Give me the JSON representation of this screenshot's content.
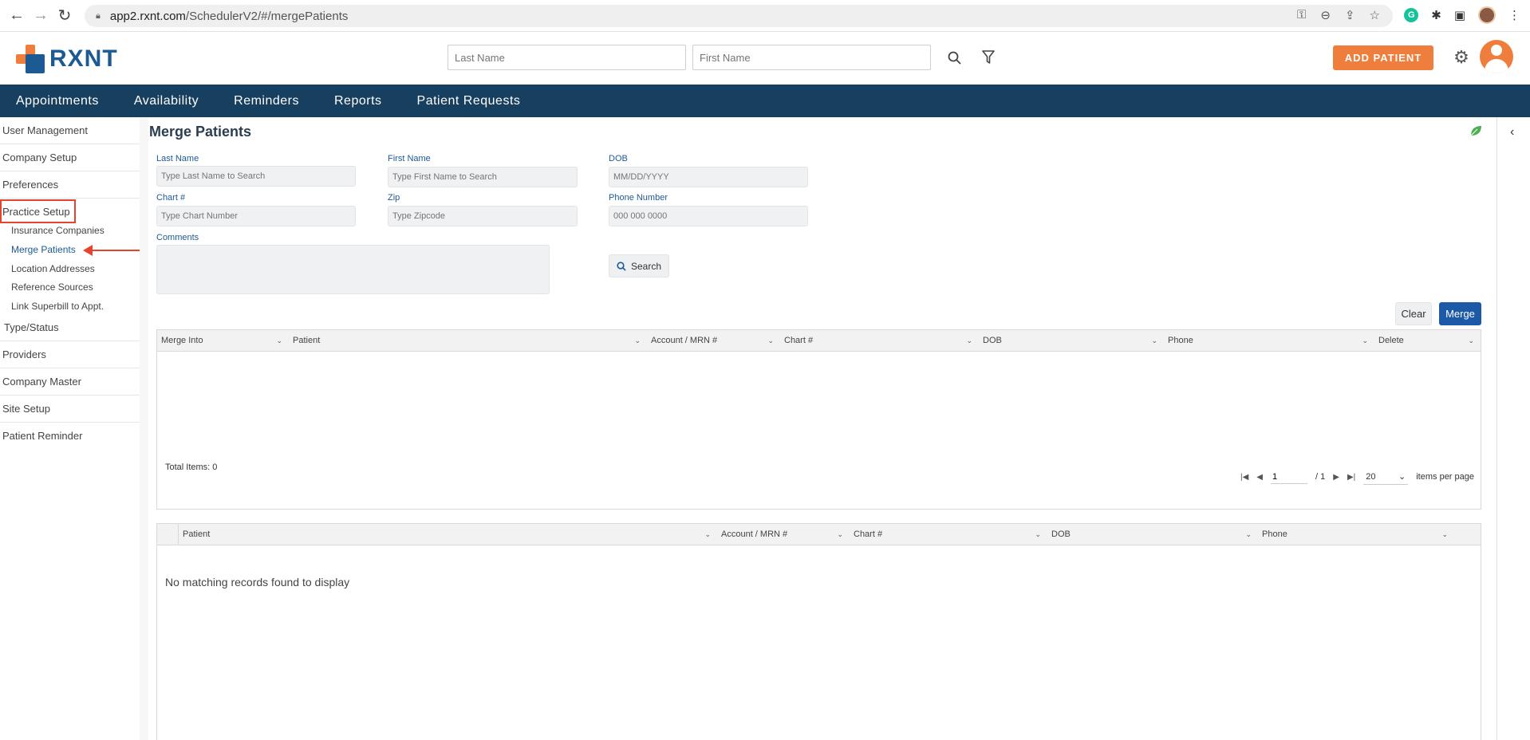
{
  "browser": {
    "url_host": "app2.rxnt.com",
    "url_path": "/SchedulerV2/#/mergePatients"
  },
  "header": {
    "logo_text": "RXNT",
    "last_name_placeholder": "Last Name",
    "first_name_placeholder": "First Name",
    "add_patient_label": "ADD PATIENT"
  },
  "nav": {
    "items": [
      "Appointments",
      "Availability",
      "Reminders",
      "Reports",
      "Patient Requests"
    ]
  },
  "sidebar": {
    "user_management": "User Management",
    "company_setup": "Company Setup",
    "preferences": "Preferences",
    "practice_setup": "Practice Setup",
    "sub_items": [
      "Insurance Companies",
      "Merge Patients",
      "Location Addresses",
      "Reference Sources",
      "Link Superbill to Appt."
    ],
    "type_status": "Type/Status",
    "providers": "Providers",
    "company_master": "Company Master",
    "site_setup": "Site Setup",
    "patient_reminder": "Patient Reminder"
  },
  "page": {
    "title": "Merge Patients"
  },
  "form": {
    "last_name_label": "Last Name",
    "last_name_placeholder": "Type Last Name to Search",
    "first_name_label": "First Name",
    "first_name_placeholder": "Type First Name to Search",
    "dob_label": "DOB",
    "dob_placeholder": "MM/DD/YYYY",
    "chart_label": "Chart #",
    "chart_placeholder": "Type Chart Number",
    "zip_label": "Zip",
    "zip_placeholder": "Type Zipcode",
    "phone_label": "Phone Number",
    "phone_placeholder": "000 000 0000",
    "comments_label": "Comments",
    "search_label": "Search",
    "clear_label": "Clear",
    "merge_label": "Merge"
  },
  "merge_grid": {
    "columns": [
      "Merge Into",
      "Patient",
      "Account / MRN #",
      "Chart #",
      "DOB",
      "Phone",
      "Delete"
    ],
    "total_items": "Total Items: 0",
    "page_value": "1",
    "page_total": "/ 1",
    "page_size": "20",
    "items_per_page": "items per page"
  },
  "results_grid": {
    "columns": [
      "Patient",
      "Account / MRN #",
      "Chart #",
      "DOB",
      "Phone"
    ],
    "empty_message": "No matching records found to display"
  }
}
